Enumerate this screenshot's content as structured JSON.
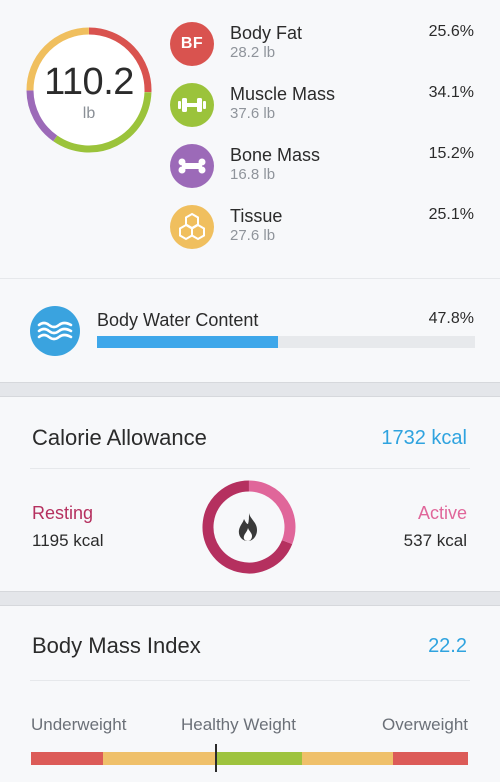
{
  "weight": {
    "value": "110.2",
    "unit": "lb"
  },
  "composition": [
    {
      "key": "body_fat",
      "name": "Body Fat",
      "weight": "28.2 lb",
      "percent": "25.6%",
      "color": "#d9534f",
      "icon": "bf-badge-icon",
      "badge_text": "BF",
      "share": 0.256
    },
    {
      "key": "muscle",
      "name": "Muscle Mass",
      "weight": "37.6 lb",
      "percent": "34.1%",
      "color": "#9bc33b",
      "icon": "dumbbell-icon",
      "share": 0.341
    },
    {
      "key": "bone",
      "name": "Bone Mass",
      "weight": "16.8 lb",
      "percent": "15.2%",
      "color": "#9c6ab8",
      "icon": "bone-icon",
      "share": 0.152
    },
    {
      "key": "tissue",
      "name": "Tissue",
      "weight": "27.6 lb",
      "percent": "25.1%",
      "color": "#f0bf5e",
      "icon": "honeycomb-icon",
      "share": 0.251
    }
  ],
  "water": {
    "label": "Body Water Content",
    "percent": "47.8%",
    "fraction": 0.478,
    "color": "#3ea7ea",
    "icon": "water-waves-icon"
  },
  "calorie": {
    "title": "Calorie Allowance",
    "total": "1732 kcal",
    "resting": {
      "label": "Resting",
      "value": "1195 kcal",
      "kcal": 1195,
      "color": "#b5305f"
    },
    "active": {
      "label": "Active",
      "value": "537 kcal",
      "kcal": 537,
      "color": "#e0669a"
    },
    "icon": "flame-icon"
  },
  "bmi": {
    "title": "Body Mass Index",
    "value": "22.2",
    "categories": [
      "Underweight",
      "Healthy Weight",
      "Overweight"
    ],
    "segments": [
      {
        "color": "#dc5b58",
        "weight": 72
      },
      {
        "color": "#efc06a",
        "weight": 113
      },
      {
        "color": "#9ec33e",
        "weight": 86
      },
      {
        "color": "#efc06a",
        "weight": 91
      },
      {
        "color": "#dc5b58",
        "weight": 75
      }
    ],
    "marker_fraction": 0.42
  }
}
